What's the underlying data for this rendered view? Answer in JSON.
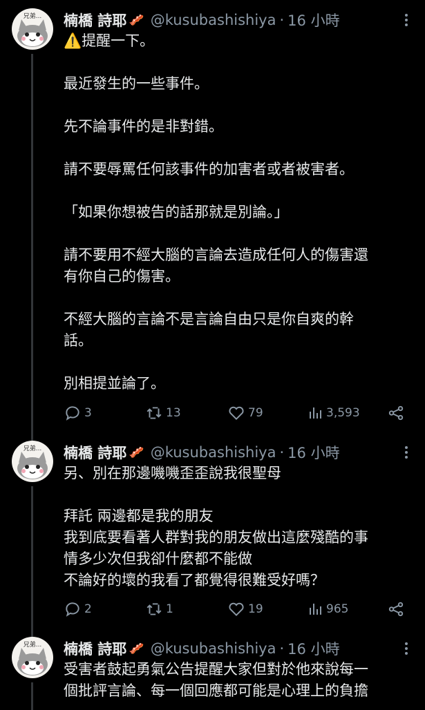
{
  "tweets": [
    {
      "name": "楠橋 詩耶",
      "name_emoji": "🥓",
      "handle": "@kusubashishiya",
      "time": "16 小時",
      "avatar_text": "兄弟...",
      "warning_icon": "⚠️",
      "lines": [
        "提醒一下。",
        "",
        "最近發生的一些事件。",
        "",
        "先不論事件的是非對錯。",
        "",
        "請不要辱罵任何該事件的加害者或者被害者。",
        "",
        "「如果你想被告的話那就是別論。」",
        "",
        "請不要用不經大腦的言論去造成任何人的傷害還",
        "有你自己的傷害。",
        "",
        "不經大腦的言論不是言論自由只是你自爽的幹",
        "話。",
        "",
        "別相提並論了。"
      ],
      "replies": "3",
      "retweets": "13",
      "likes": "79",
      "views": "3,593"
    },
    {
      "name": "楠橋 詩耶",
      "name_emoji": "🥓",
      "handle": "@kusubashishiya",
      "time": "16 小時",
      "avatar_text": "兄弟...",
      "lines": [
        "另、別在那邊嘰嘰歪歪說我很聖母",
        "",
        "拜託 兩邊都是我的朋友",
        "我到底要看著人群對我的朋友做出這麼殘酷的事",
        "情多少次但我卻什麼都不能做",
        "不論好的壞的我看了都覺得很難受好嗎？"
      ],
      "replies": "2",
      "retweets": "1",
      "likes": "19",
      "views": "965"
    },
    {
      "name": "楠橋 詩耶",
      "name_emoji": "🥓",
      "handle": "@kusubashishiya",
      "time": "16 小時",
      "avatar_text": "兄弟...",
      "lines": [
        "受害者鼓起勇氣公告提醒大家但對於他來說每一",
        "個批評言論、每一個回應都可能是心理上的負擔"
      ]
    }
  ],
  "icons": {
    "reply": "reply-icon",
    "retweet": "retweet-icon",
    "like": "heart-icon",
    "views": "views-icon",
    "share": "share-icon",
    "more": "more-icon"
  },
  "colors": {
    "background": "#000000",
    "text": "#e7e9ea",
    "muted": "#8b98a5",
    "thread_line": "#333639",
    "warning": "#f4c430"
  }
}
